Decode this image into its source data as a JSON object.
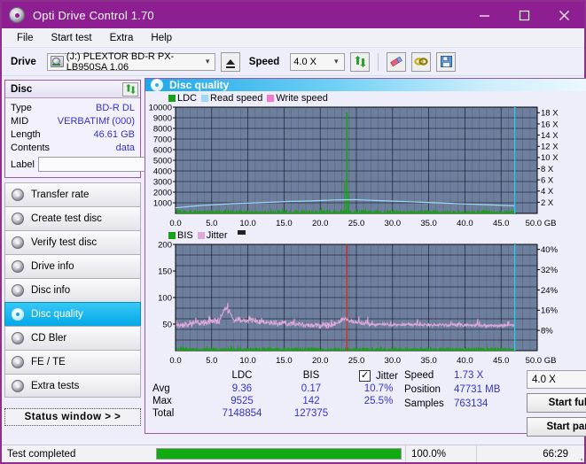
{
  "window": {
    "title": "Opti Drive Control 1.70",
    "icon": "disc-icon",
    "minimize": "minimize-icon",
    "maximize": "maximize-icon",
    "close": "close-icon"
  },
  "menu": [
    {
      "label": "File"
    },
    {
      "label": "Start test"
    },
    {
      "label": "Extra"
    },
    {
      "label": "Help"
    }
  ],
  "toolbar": {
    "drive_label": "Drive",
    "drive_value": "(J:)  PLEXTOR BD-R  PX-LB950SA 1.06",
    "eject_icon": "eject-icon",
    "speed_label": "Speed",
    "speed_value": "4.0 X",
    "refresh_icon": "refresh-icon",
    "eraser_icon": "eraser-icon",
    "plug_icon": "plug-icon",
    "save_icon": "save-icon"
  },
  "disc": {
    "header": "Disc",
    "refresh_icon": "refresh-icon",
    "rows": [
      {
        "key": "Type",
        "value": "BD-R DL"
      },
      {
        "key": "MID",
        "value": "VERBATIMf (000)"
      },
      {
        "key": "Length",
        "value": "46.61 GB"
      },
      {
        "key": "Contents",
        "value": "data"
      }
    ],
    "label_key": "Label",
    "label_value": "",
    "label_placeholder": "",
    "disc_button_icon": "cd-icon"
  },
  "sidebar": {
    "items": [
      {
        "label": "Transfer rate",
        "icon": "disc-icon",
        "active": false
      },
      {
        "label": "Create test disc",
        "icon": "disc-icon",
        "active": false
      },
      {
        "label": "Verify test disc",
        "icon": "disc-icon",
        "active": false
      },
      {
        "label": "Drive info",
        "icon": "disc-icon",
        "active": false
      },
      {
        "label": "Disc info",
        "icon": "disc-icon",
        "active": false
      },
      {
        "label": "Disc quality",
        "icon": "disc-icon",
        "active": true
      },
      {
        "label": "CD Bler",
        "icon": "disc-icon",
        "active": false
      },
      {
        "label": "FE / TE",
        "icon": "disc-icon",
        "active": false
      },
      {
        "label": "Extra tests",
        "icon": "disc-icon",
        "active": false
      }
    ],
    "status_window": "Status window > >"
  },
  "content": {
    "header": "Disc quality",
    "header_icon": "disc-icon"
  },
  "stats": {
    "columns": [
      "",
      "LDC",
      "BIS",
      "Jitter"
    ],
    "jitter_checked": true,
    "jitter_check_glyph": "✓",
    "rows": [
      {
        "label": "Avg",
        "ldc": "9.36",
        "bis": "0.17",
        "jitter": "10.7%"
      },
      {
        "label": "Max",
        "ldc": "9525",
        "bis": "142",
        "jitter": "25.5%"
      },
      {
        "label": "Total",
        "ldc": "7148854",
        "bis": "127375",
        "jitter": ""
      }
    ]
  },
  "run_info": {
    "speed_key": "Speed",
    "speed_value": "1.73 X",
    "position_key": "Position",
    "position_value": "47731 MB",
    "samples_key": "Samples",
    "samples_value": "763134",
    "speed_select": "4.0 X",
    "start_full": "Start full",
    "start_part": "Start part"
  },
  "statusbar": {
    "message": "Test completed",
    "progress_percent": 100.0,
    "progress_text": "100.0%",
    "elapsed": "66:29"
  },
  "colors": {
    "accent_purple": "#8e1f93",
    "plot_bg": "#6e7f9e",
    "ldc_green": "#18a018",
    "bis_green": "#18a018",
    "read_speed": "#9fd8f2",
    "write_speed": "#f07ad0",
    "jitter_pink": "#e0a8d8",
    "marker_cyan": "#22d0f0",
    "value_blue": "#3333cc",
    "progress_green": "#11aa11"
  },
  "chart_data": [
    {
      "type": "line",
      "id": "top-chart",
      "title": "Disc quality",
      "legend": [
        {
          "name": "LDC",
          "color": "#18a018"
        },
        {
          "name": "Read speed",
          "color": "#9fd8f2"
        },
        {
          "name": "Write speed",
          "color": "#f07ad0"
        }
      ],
      "legend_position": "top-left",
      "grid": true,
      "xlabel": "GB",
      "xlim": [
        0,
        50
      ],
      "xticks": [
        "0.0",
        "5.0",
        "10.0",
        "15.0",
        "20.0",
        "25.0",
        "30.0",
        "35.0",
        "40.0",
        "45.0",
        "50.0 GB"
      ],
      "ylabel_left": "LDC",
      "ylim_left": [
        0,
        10000
      ],
      "yticks_left": [
        "10000",
        "9000",
        "8000",
        "7000",
        "6000",
        "5000",
        "4000",
        "3000",
        "2000",
        "1000"
      ],
      "ylabel_right": "Speed",
      "ylim_right": [
        0,
        19
      ],
      "yticks_right": [
        "18 X",
        "16 X",
        "14 X",
        "12 X",
        "10 X",
        "8 X",
        "6 X",
        "4 X",
        "2 X"
      ],
      "end_marker_x": 46.9,
      "series": [
        {
          "name": "Read speed",
          "color": "#9fd8f2",
          "axis": "right",
          "x": [
            0,
            2,
            4,
            6,
            8,
            10,
            12,
            14,
            16,
            18,
            20,
            22,
            24,
            25,
            26,
            28,
            30,
            32,
            34,
            36,
            38,
            40,
            42,
            44,
            46,
            46.9
          ],
          "values": [
            1.0,
            1.25,
            1.45,
            1.6,
            1.75,
            1.85,
            1.95,
            2.05,
            2.15,
            2.2,
            2.3,
            2.4,
            2.45,
            2.45,
            2.4,
            2.3,
            2.2,
            2.1,
            2.0,
            1.9,
            1.8,
            1.7,
            1.6,
            1.5,
            1.4,
            1.35
          ]
        },
        {
          "name": "LDC",
          "color": "#18a018",
          "axis": "left",
          "note": "dense per-sample bars along baseline, avg 9.36, max 9525 spike at ~23.6 GB",
          "spike_x": 23.6,
          "spike_value": 9525,
          "baseline_avg": 9.36
        }
      ]
    },
    {
      "type": "line",
      "id": "bottom-chart",
      "legend": [
        {
          "name": "BIS",
          "color": "#18a018"
        },
        {
          "name": "Jitter",
          "color": "#e0a8d8"
        }
      ],
      "legend_position": "top-left",
      "grid": true,
      "xlabel": "GB",
      "xlim": [
        0,
        50
      ],
      "xticks": [
        "0.0",
        "5.0",
        "10.0",
        "15.0",
        "20.0",
        "25.0",
        "30.0",
        "35.0",
        "40.0",
        "45.0",
        "50.0 GB"
      ],
      "ylabel_left": "BIS",
      "ylim_left": [
        0,
        200
      ],
      "yticks_left": [
        "200",
        "150",
        "100",
        "50"
      ],
      "ylabel_right": "Jitter",
      "ylim_right": [
        0,
        42
      ],
      "yticks_right": [
        "40%",
        "32%",
        "24%",
        "16%",
        "8%"
      ],
      "end_marker_x": 46.9,
      "series": [
        {
          "name": "Jitter",
          "color": "#e0a8d8",
          "axis": "right",
          "units": "%",
          "avg": 10.7,
          "max": 25.5,
          "x": [
            0,
            2,
            4,
            6,
            7,
            8,
            10,
            12,
            14,
            16,
            18,
            20,
            22,
            23.5,
            24,
            26,
            28,
            30,
            32,
            34,
            36,
            38,
            40,
            42,
            44,
            46,
            46.9
          ],
          "values": [
            10.2,
            10.6,
            11.1,
            11.6,
            17.2,
            12.0,
            12.2,
            11.6,
            10.8,
            10.4,
            10.2,
            9.9,
            10.3,
            12.8,
            11.6,
            10.6,
            10.3,
            10.2,
            10.3,
            10.2,
            10.1,
            10.1,
            10.0,
            10.0,
            9.9,
            9.9,
            9.9
          ]
        },
        {
          "name": "BIS",
          "color": "#18a018",
          "axis": "left",
          "note": "low baseline bars across entire disc, avg 0.17, max 142 at ~23.6 GB",
          "spike_x": 23.6,
          "spike_value": 142,
          "baseline_avg": 0.17
        }
      ]
    }
  ]
}
